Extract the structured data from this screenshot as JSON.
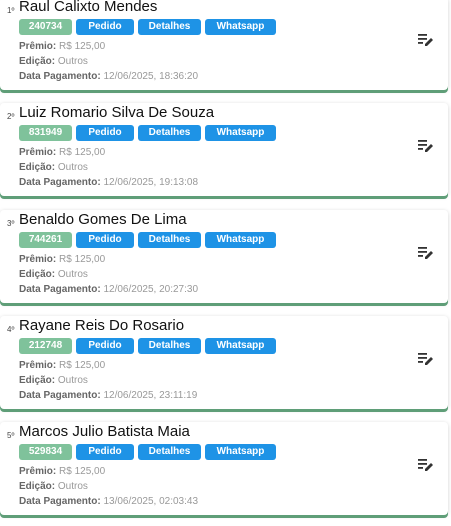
{
  "labels": {
    "premio": "Prêmio:",
    "edicao": "Edição:",
    "data_pagamento": "Data Pagamento:",
    "pedido": "Pedido",
    "detalhes": "Detalhes",
    "whatsapp": "Whatsapp"
  },
  "entries": [
    {
      "rank": "1º",
      "name": "Raul Calixto Mendes",
      "code": "240734",
      "premio": "R$ 125,00",
      "edicao": "Outros",
      "data_pagamento": "12/06/2025, 18:36:20"
    },
    {
      "rank": "2º",
      "name": "Luiz Romario Silva De Souza",
      "code": "831949",
      "premio": "R$ 125,00",
      "edicao": "Outros",
      "data_pagamento": "12/06/2025, 19:13:08"
    },
    {
      "rank": "3º",
      "name": "Benaldo Gomes De Lima",
      "code": "744261",
      "premio": "R$ 125,00",
      "edicao": "Outros",
      "data_pagamento": "12/06/2025, 20:27:30"
    },
    {
      "rank": "4º",
      "name": "Rayane Reis Do Rosario",
      "code": "212748",
      "premio": "R$ 125,00",
      "edicao": "Outros",
      "data_pagamento": "12/06/2025, 23:11:19"
    },
    {
      "rank": "5º",
      "name": "Marcos Julio Batista Maia",
      "code": "529834",
      "premio": "R$ 125,00",
      "edicao": "Outros",
      "data_pagamento": "13/06/2025, 02:03:43"
    }
  ],
  "colors": {
    "code_badge": "#7fc29b",
    "button": "#1e93e6",
    "card_accent": "#5f9e78"
  },
  "icons": {
    "edit": "edit-note-icon"
  }
}
